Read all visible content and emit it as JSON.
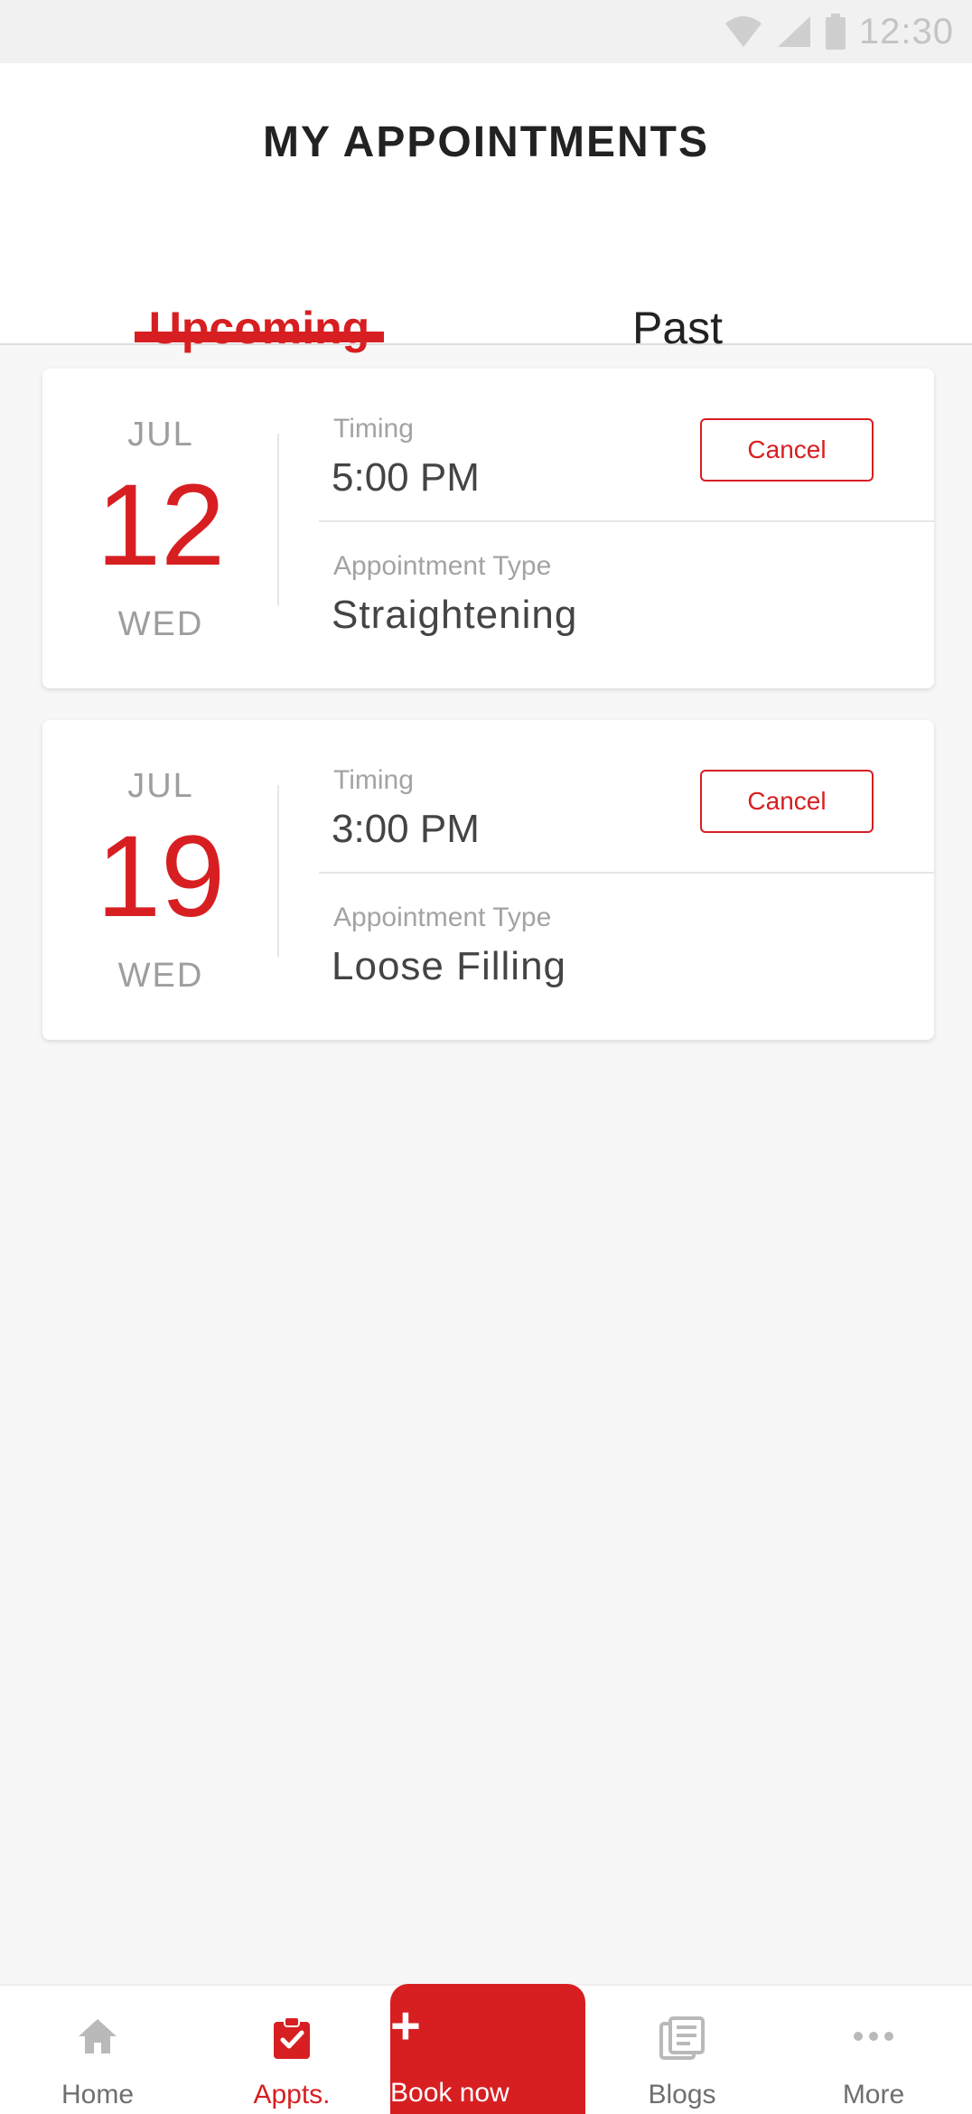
{
  "status_bar": {
    "time": "12:30"
  },
  "header": {
    "title": "MY APPOINTMENTS",
    "tabs": [
      {
        "label": "Upcoming",
        "active": true
      },
      {
        "label": "Past",
        "active": false
      }
    ]
  },
  "appointments": [
    {
      "month": "JUL",
      "day": "12",
      "weekday": "WED",
      "timing_label": "Timing",
      "timing": "5:00 PM",
      "type_label": "Appointment Type",
      "type": "Straightening",
      "cancel_label": "Cancel"
    },
    {
      "month": "JUL",
      "day": "19",
      "weekday": "WED",
      "timing_label": "Timing",
      "timing": "3:00 PM",
      "type_label": "Appointment Type",
      "type": "Loose Filling",
      "cancel_label": "Cancel"
    }
  ],
  "bottom_nav": {
    "items": [
      {
        "label": "Home",
        "icon": "home-icon"
      },
      {
        "label": "Appts.",
        "icon": "clipboard-check-icon",
        "active": true
      },
      {
        "label": "Book now",
        "icon": "plus-icon"
      },
      {
        "label": "Blogs",
        "icon": "stacked-pages-icon"
      },
      {
        "label": "More",
        "icon": "more-dots-icon"
      }
    ]
  },
  "colors": {
    "accent": "#d71f22",
    "background": "#f7f7f7"
  }
}
